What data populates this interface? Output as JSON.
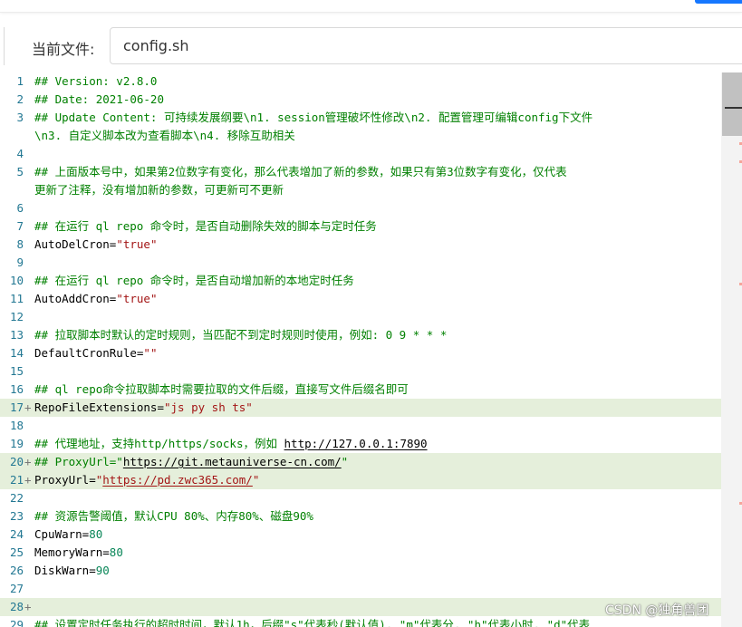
{
  "file_bar": {
    "label": "当前文件:",
    "file_name": "config.sh"
  },
  "editor": {
    "lines": [
      {
        "num": "1",
        "segments": [
          {
            "t": "## Version: v2.8.0",
            "c": "cmt"
          }
        ]
      },
      {
        "num": "2",
        "segments": [
          {
            "t": "## Date: 2021-06-20",
            "c": "cmt"
          }
        ]
      },
      {
        "num": "3",
        "segments": [
          {
            "t": "## Update Content: 可持续发展纲要\\n1. session管理破坏性修改\\n2. 配置管理可编辑config下文件",
            "c": "cmt"
          }
        ]
      },
      {
        "num": "",
        "segments": [
          {
            "t": "\\n3. 自定义脚本改为查看脚本\\n4. 移除互助相关",
            "c": "cmt"
          }
        ]
      },
      {
        "num": "4",
        "segments": []
      },
      {
        "num": "5",
        "segments": [
          {
            "t": "## 上面版本号中，如果第2位数字有变化，那么代表增加了新的参数，如果只有第3位数字有变化，仅代表",
            "c": "cmt"
          }
        ]
      },
      {
        "num": "",
        "segments": [
          {
            "t": "更新了注释，没有增加新的参数，可更新可不更新",
            "c": "cmt"
          }
        ]
      },
      {
        "num": "6",
        "segments": []
      },
      {
        "num": "7",
        "segments": [
          {
            "t": "## 在运行 ql repo 命令时，是否自动删除失效的脚本与定时任务",
            "c": "cmt"
          }
        ]
      },
      {
        "num": "8",
        "segments": [
          {
            "t": "AutoDelCron=",
            "c": "key"
          },
          {
            "t": "\"true\"",
            "c": "str"
          }
        ]
      },
      {
        "num": "9",
        "segments": []
      },
      {
        "num": "10",
        "segments": [
          {
            "t": "## 在运行 ql repo 命令时，是否自动增加新的本地定时任务",
            "c": "cmt"
          }
        ]
      },
      {
        "num": "11",
        "segments": [
          {
            "t": "AutoAddCron=",
            "c": "key"
          },
          {
            "t": "\"true\"",
            "c": "str"
          }
        ]
      },
      {
        "num": "12",
        "segments": []
      },
      {
        "num": "13",
        "segments": [
          {
            "t": "## 拉取脚本时默认的定时规则，当匹配不到定时规则时使用，例如: 0 9 * * *",
            "c": "cmt"
          }
        ]
      },
      {
        "num": "14",
        "segments": [
          {
            "t": "DefaultCronRule=",
            "c": "key"
          },
          {
            "t": "\"\"",
            "c": "str"
          }
        ]
      },
      {
        "num": "15",
        "segments": []
      },
      {
        "num": "16",
        "segments": [
          {
            "t": "## ql repo命令拉取脚本时需要拉取的文件后缀，直接写文件后缀名即可",
            "c": "cmt"
          }
        ]
      },
      {
        "num": "17",
        "changed": true,
        "segments": [
          {
            "t": "RepoFileExtensions=",
            "c": "key"
          },
          {
            "t": "\"js py sh ts\"",
            "c": "str"
          }
        ]
      },
      {
        "num": "18",
        "segments": []
      },
      {
        "num": "19",
        "segments": [
          {
            "t": "## 代理地址，支持http/https/socks，例如 ",
            "c": "cmt"
          },
          {
            "t": "http://127.0.0.1:7890",
            "c": "cmtlink"
          }
        ]
      },
      {
        "num": "20",
        "changed": true,
        "segments": [
          {
            "t": "## ProxyUrl=\"",
            "c": "cmt"
          },
          {
            "t": "https://git.metauniverse-cn.com/",
            "c": "cmtlink"
          },
          {
            "t": "\"",
            "c": "cmt"
          }
        ]
      },
      {
        "num": "21",
        "changed": true,
        "segments": [
          {
            "t": "ProxyUrl=",
            "c": "key"
          },
          {
            "t": "\"",
            "c": "str"
          },
          {
            "t": "https://pd.zwc365.com/",
            "c": "str link"
          },
          {
            "t": "\"",
            "c": "str"
          }
        ]
      },
      {
        "num": "22",
        "segments": []
      },
      {
        "num": "23",
        "segments": [
          {
            "t": "## 资源告警阈值，默认CPU 80%、内存80%、磁盘90%",
            "c": "cmt"
          }
        ]
      },
      {
        "num": "24",
        "segments": [
          {
            "t": "CpuWarn=",
            "c": "key"
          },
          {
            "t": "80",
            "c": "num"
          }
        ]
      },
      {
        "num": "25",
        "segments": [
          {
            "t": "MemoryWarn=",
            "c": "key"
          },
          {
            "t": "80",
            "c": "num"
          }
        ]
      },
      {
        "num": "26",
        "segments": [
          {
            "t": "DiskWarn=",
            "c": "key"
          },
          {
            "t": "90",
            "c": "num"
          }
        ]
      },
      {
        "num": "27",
        "segments": []
      },
      {
        "num": "28",
        "changed": true,
        "segments": []
      },
      {
        "num": "29",
        "segments": [
          {
            "t": "## 设置定时任务执行的超时时间，默认1h，后缀\"s\"代表秒(默认值), \"m\"代表分, \"h\"代表小时, \"d\"代表",
            "c": "cmt"
          }
        ]
      }
    ]
  },
  "watermark": "CSDN @独角兽团"
}
